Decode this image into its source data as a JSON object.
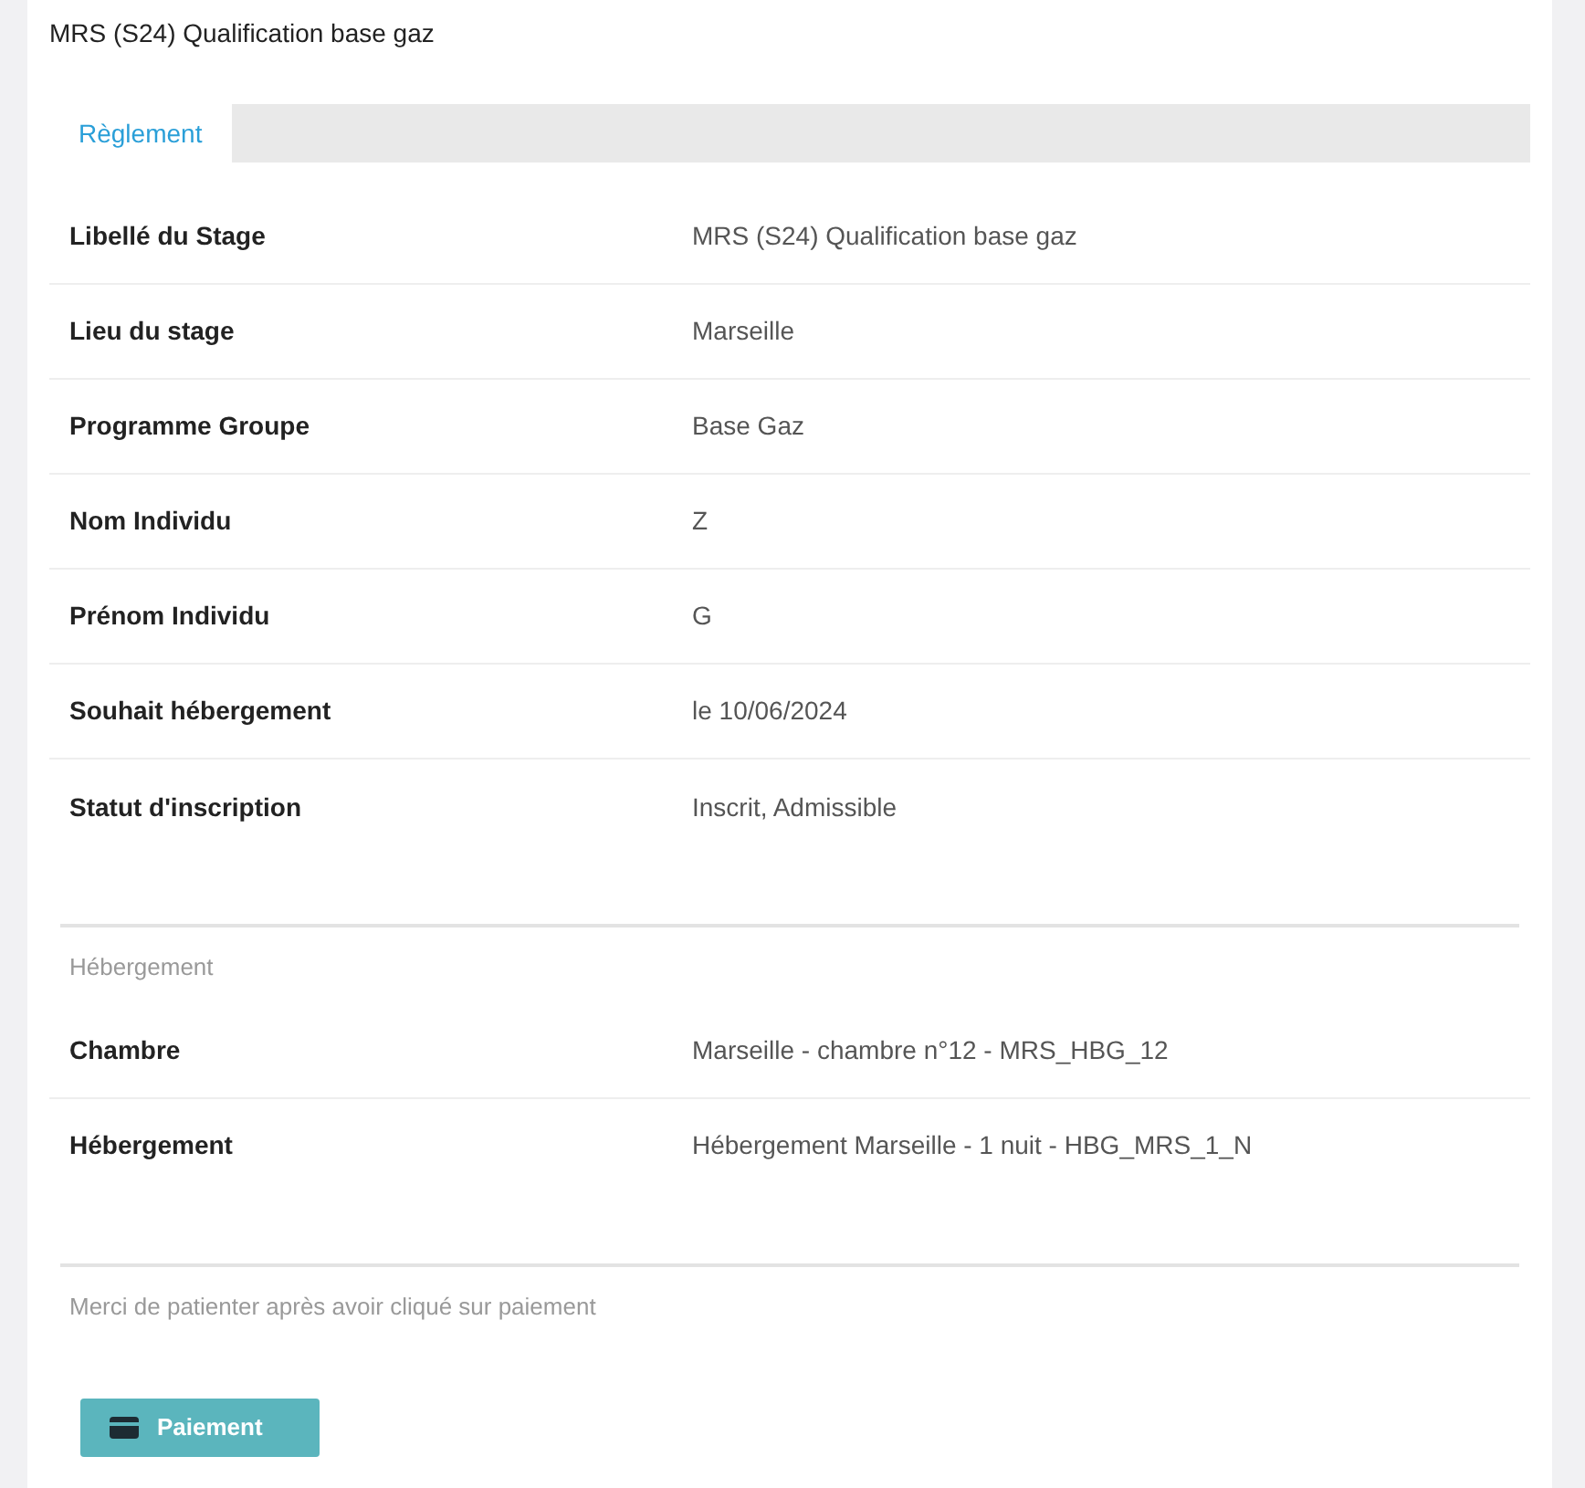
{
  "title": "MRS (S24) Qualification base gaz",
  "tabs": [
    {
      "label": "Règlement",
      "selected": true
    }
  ],
  "details": [
    {
      "label": "Libellé du Stage",
      "value": "MRS (S24) Qualification base gaz"
    },
    {
      "label": "Lieu du stage",
      "value": "Marseille"
    },
    {
      "label": "Programme Groupe",
      "value": "Base Gaz"
    },
    {
      "label": "Nom Individu",
      "value": "Z"
    },
    {
      "label": "Prénom Individu",
      "value": "G"
    },
    {
      "label": "Souhait hébergement",
      "value": "le 10/06/2024"
    },
    {
      "label": "Statut d'inscription",
      "value": "Inscrit, Admissible"
    }
  ],
  "accommodation": {
    "heading": "Hébergement",
    "rows": [
      {
        "label": "Chambre",
        "value": "Marseille - chambre n°12 - MRS_HBG_12"
      },
      {
        "label": "Hébergement",
        "value": "Hébergement Marseille - 1 nuit - HBG_MRS_1_N"
      }
    ]
  },
  "notice": "Merci de patienter après avoir cliqué sur paiement",
  "pay_button": "Paiement"
}
